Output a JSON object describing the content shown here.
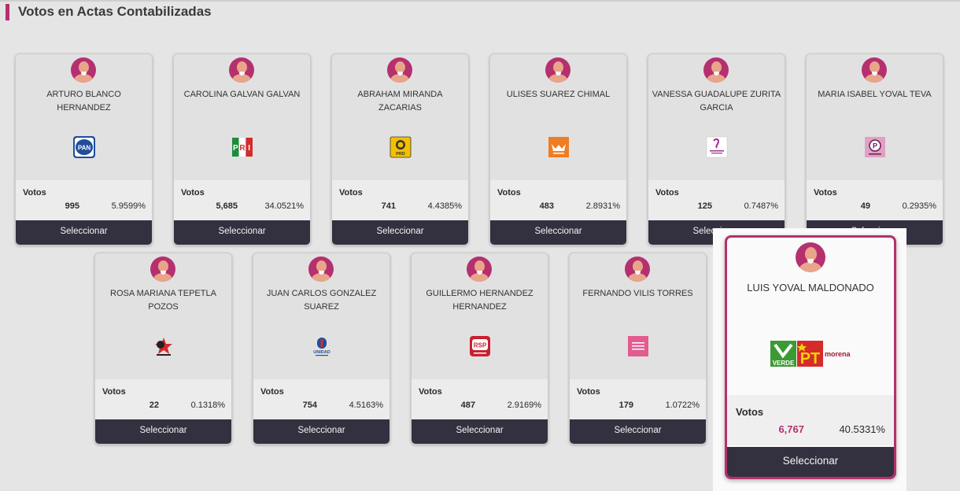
{
  "header": {
    "title": "Votos en Actas Contabilizadas"
  },
  "labels": {
    "votes": "Votos",
    "select": "Seleccionar"
  },
  "colors": {
    "accent": "#b5306f",
    "button": "#33303f"
  },
  "candidates": [
    {
      "name": "ARTURO BLANCO HERNANDEZ",
      "party_icon": "pan-logo",
      "votes": "995",
      "percent": "5.9599%"
    },
    {
      "name": "CAROLINA GALVAN GALVAN",
      "party_icon": "pri-logo",
      "votes": "5,685",
      "percent": "34.0521%"
    },
    {
      "name": "ABRAHAM MIRANDA ZACARIAS",
      "party_icon": "prd-logo",
      "votes": "741",
      "percent": "4.4385%"
    },
    {
      "name": "ULISES SUAREZ CHIMAL",
      "party_icon": "movimiento-ciudadano-logo",
      "votes": "483",
      "percent": "2.8931%"
    },
    {
      "name": "VANESSA GUADALUPE ZURITA GARCIA",
      "party_icon": "todos-por-veracruz-logo",
      "votes": "125",
      "percent": "0.7487%"
    },
    {
      "name": "MARIA ISABEL YOVAL TEVA",
      "party_icon": "podemos-logo",
      "votes": "49",
      "percent": "0.2935%"
    },
    {
      "name": "ROSA MARIANA TEPETLA POZOS",
      "party_icon": "cardenista-logo",
      "votes": "22",
      "percent": "0.1318%"
    },
    {
      "name": "JUAN CARLOS GONZALEZ SUAREZ",
      "party_icon": "unidad-ciudadana-logo",
      "votes": "754",
      "percent": "4.5163%"
    },
    {
      "name": "GUILLERMO HERNANDEZ HERNANDEZ",
      "party_icon": "rsp-logo",
      "votes": "487",
      "percent": "2.9169%"
    },
    {
      "name": "FERNANDO VILIS TORRES",
      "party_icon": "fuerza-por-mexico-logo",
      "votes": "179",
      "percent": "1.0722%"
    }
  ],
  "highlighted": {
    "name": "LUIS YOVAL MALDONADO",
    "party_icon": "verde-pt-morena-logo",
    "logo_text": {
      "verde": "VERDE",
      "pt": "PT",
      "morena": "morena"
    },
    "votes": "6,767",
    "percent": "40.5331%"
  }
}
